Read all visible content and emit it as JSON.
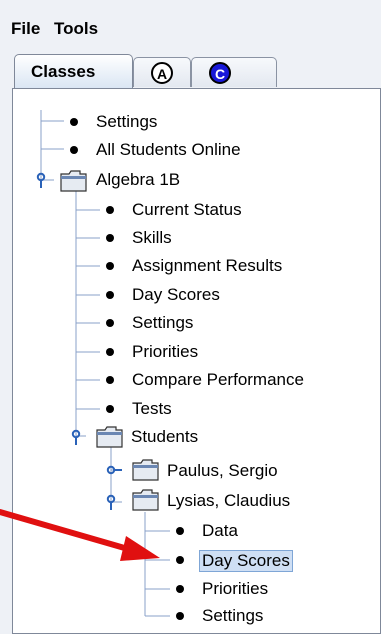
{
  "menu": {
    "file_label": "File",
    "tools_label": "Tools"
  },
  "tabs": {
    "classes_label": "Classes",
    "a_badge": "A",
    "c_badge": "C",
    "colors": {
      "c_badge_bg": "#1818d8"
    }
  },
  "tree": {
    "root_settings": "Settings",
    "all_students": "All Students Online",
    "class_name": "Algebra 1B",
    "class_children": {
      "current_status": "Current Status",
      "skills": "Skills",
      "assignment_results": "Assignment Results",
      "day_scores": "Day Scores",
      "settings": "Settings",
      "priorities": "Priorities",
      "compare_performance": "Compare Performance",
      "tests": "Tests"
    },
    "students_label": "Students",
    "students": [
      {
        "name": "Paulus, Sergio",
        "expanded": false
      },
      {
        "name": "Lysias, Claudius",
        "expanded": true
      }
    ],
    "student_children": {
      "data": "Data",
      "day_scores": "Day Scores",
      "priorities": "Priorities",
      "settings": "Settings"
    },
    "selected_item": "Day Scores"
  },
  "annotation": {
    "arrow_color": "#e01010"
  }
}
